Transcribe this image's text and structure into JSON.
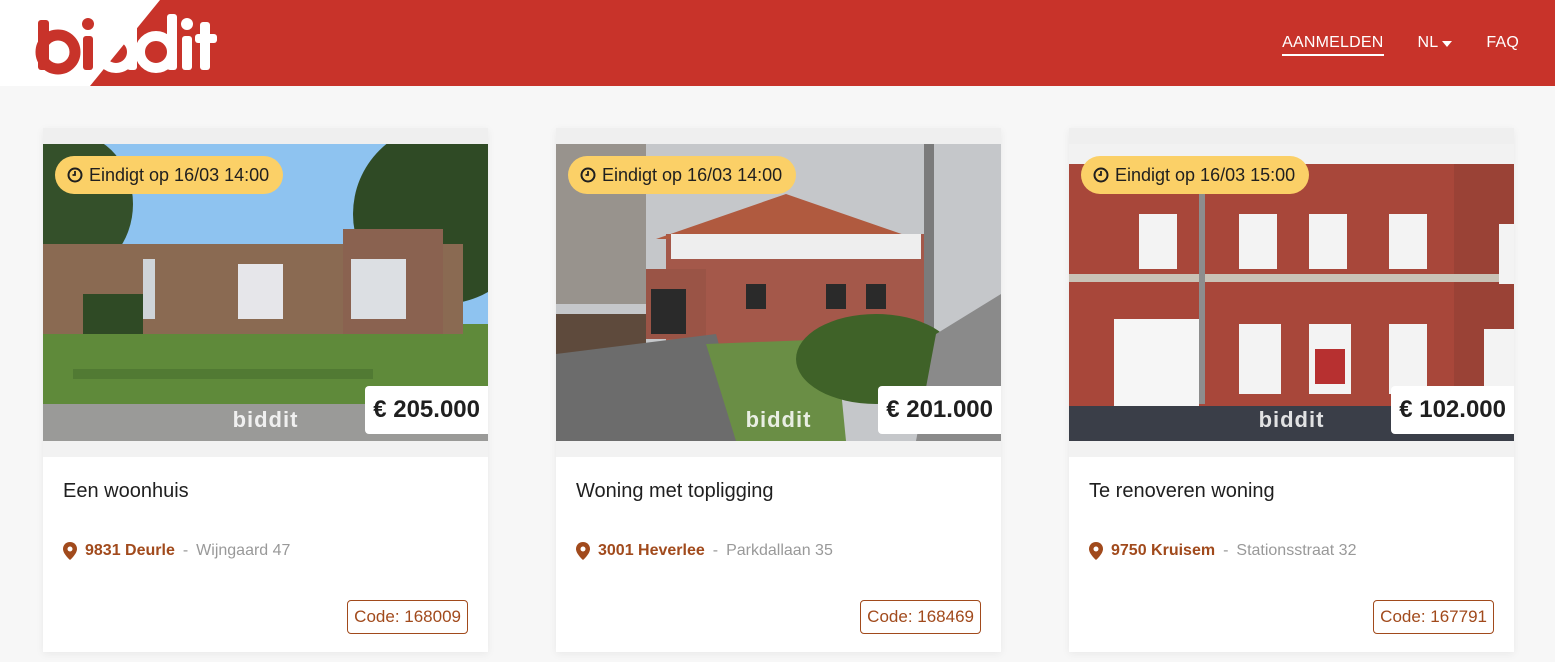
{
  "brand": {
    "logo_text": "biddit",
    "accent": "#c8332a",
    "badge_color": "#fbd067",
    "link_color": "#a14a1c"
  },
  "nav": {
    "login": "AANMELDEN",
    "language": "NL",
    "faq": "FAQ"
  },
  "listings": [
    {
      "ends": "Eindigt op 16/03 14:00",
      "price": "€ 205.000",
      "watermark": "biddit",
      "title": "Een woonhuis",
      "city": "9831 Deurle",
      "separator": " - ",
      "street": "Wijngaard 47",
      "code": "Code: 168009"
    },
    {
      "ends": "Eindigt op 16/03 14:00",
      "price": "€ 201.000",
      "watermark": "biddit",
      "title": "Woning met topligging",
      "city": "3001 Heverlee",
      "separator": " - ",
      "street": "Parkdallaan 35",
      "code": "Code: 168469"
    },
    {
      "ends": "Eindigt op 16/03 15:00",
      "price": "€ 102.000",
      "watermark": "biddit",
      "title": "Te renoveren woning",
      "city": "9750 Kruisem",
      "separator": " - ",
      "street": "Stationsstraat 32",
      "code": "Code: 167791"
    }
  ]
}
